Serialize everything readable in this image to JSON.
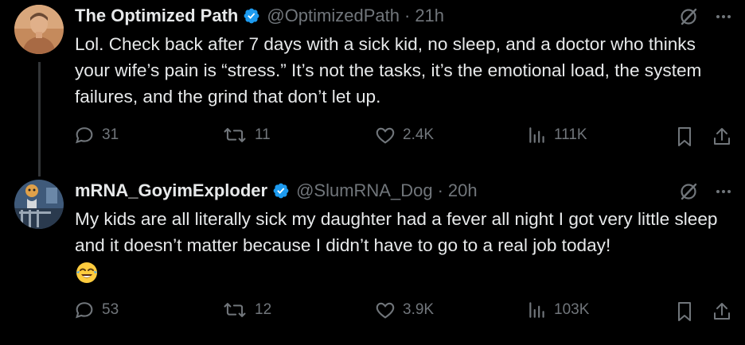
{
  "tweets": [
    {
      "name": "The Optimized Path",
      "handle": "@OptimizedPath",
      "separator": "·",
      "time": "21h",
      "text": "Lol. Check back after 7 days with a sick kid, no sleep, and a doctor who thinks your wife’s pain is “stress.” It’s not the tasks, it’s the emotional load, the system failures, and the grind that don’t let up.",
      "replies": "31",
      "reposts": "11",
      "likes": "2.4K",
      "views": "111K",
      "avatar_icon": "person-photo-avatar"
    },
    {
      "name": "mRNA_GoyimExploder",
      "handle": "@SlumRNA_Dog",
      "separator": "·",
      "time": "20h",
      "text": "My kids are all literally sick my daughter had a fever all night I got very little sleep and it doesn’t matter because I didn’t have to go to a real job today!",
      "emoji_icon": "face-with-tears-of-joy",
      "replies": "53",
      "reposts": "12",
      "likes": "3.9K",
      "views": "103K",
      "avatar_icon": "dog-photo-avatar"
    }
  ],
  "colors": {
    "background": "#000000",
    "text": "#e7e9ea",
    "muted": "#71767b",
    "verified": "#1d9bf0"
  }
}
